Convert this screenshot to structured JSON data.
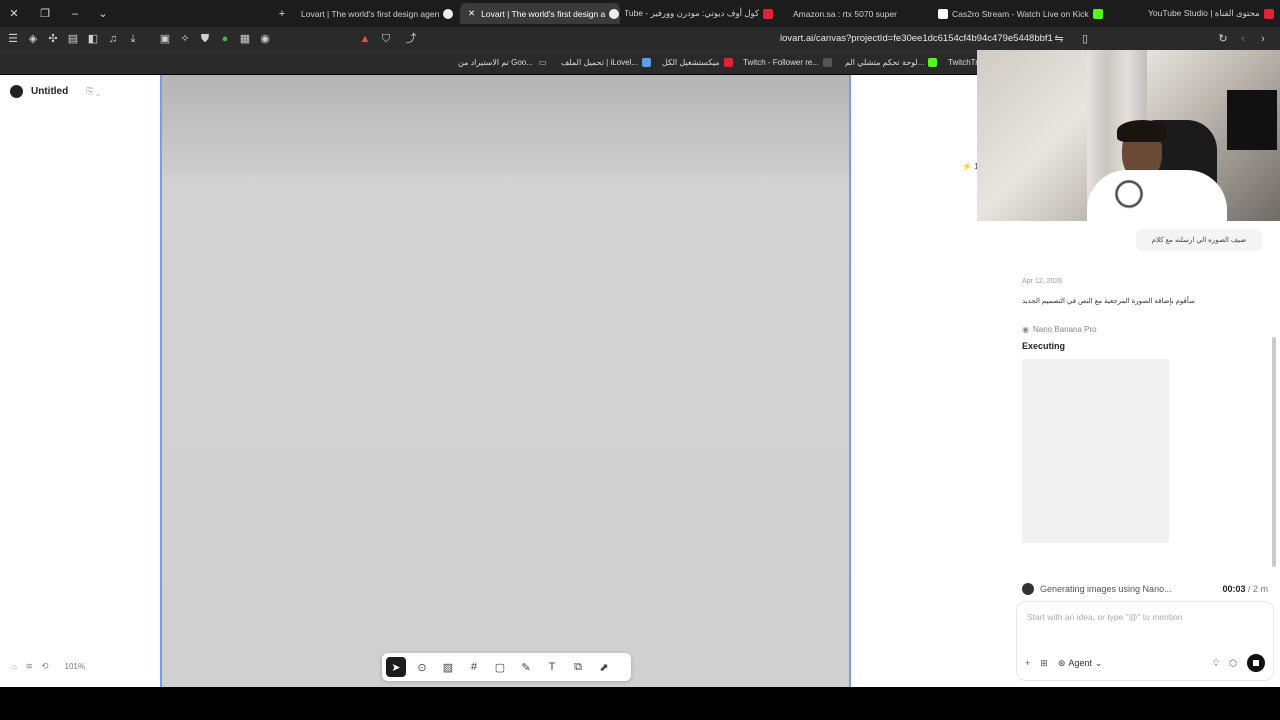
{
  "browser": {
    "tabs": [
      {
        "label": "Lovart | The world's first design agen",
        "active": false
      },
      {
        "label": "Lovart | The world's first design a",
        "active": true
      },
      {
        "label": "كول أوف ديوتي: مودرن وورفير - Tube",
        "active": false
      },
      {
        "label": "Amazon.sa : rtx 5070 super",
        "active": false
      },
      {
        "label": "Cas2ro Stream - Watch Live on Kick",
        "active": false
      },
      {
        "label": "YouTube Studio | محتوى القناة",
        "active": false
      }
    ],
    "url": "lovart.ai/canvas?projectId=fe30ee1dc6154cf4b94c479e5448bbf1",
    "bookmarks": [
      "TwitchTr",
      "لوحة تحكم متشلي الم...",
      "Twitch - Follower re...",
      "ميكستشغيل الكل",
      "تحميل الملف | iLovel...",
      "تم الاستيراد من Goo..."
    ]
  },
  "app": {
    "project_title": "Untitled",
    "zoom_level": "101%",
    "credits_text": "1",
    "bottom_tools": [
      "select",
      "marker",
      "image",
      "frame",
      "rectangle",
      "pencil",
      "text",
      "image-gen",
      "video-gen"
    ]
  },
  "chat": {
    "user_message": "ضيف الصوره الي ارسلته مع كلام",
    "date": "Apr 12, 2026",
    "assistant_reply": "سأقوم بإضافة الصورة المرجعية مع النص في التصميم الجديد",
    "model_name": "Nano Banana Pro",
    "status_label": "Executing",
    "generating_text": "Generating images using Nano...",
    "elapsed": "00:03",
    "total": " / 2 m",
    "input_placeholder": "Start with an idea, or type \"@\" to mention",
    "agent_label": "Agent"
  }
}
